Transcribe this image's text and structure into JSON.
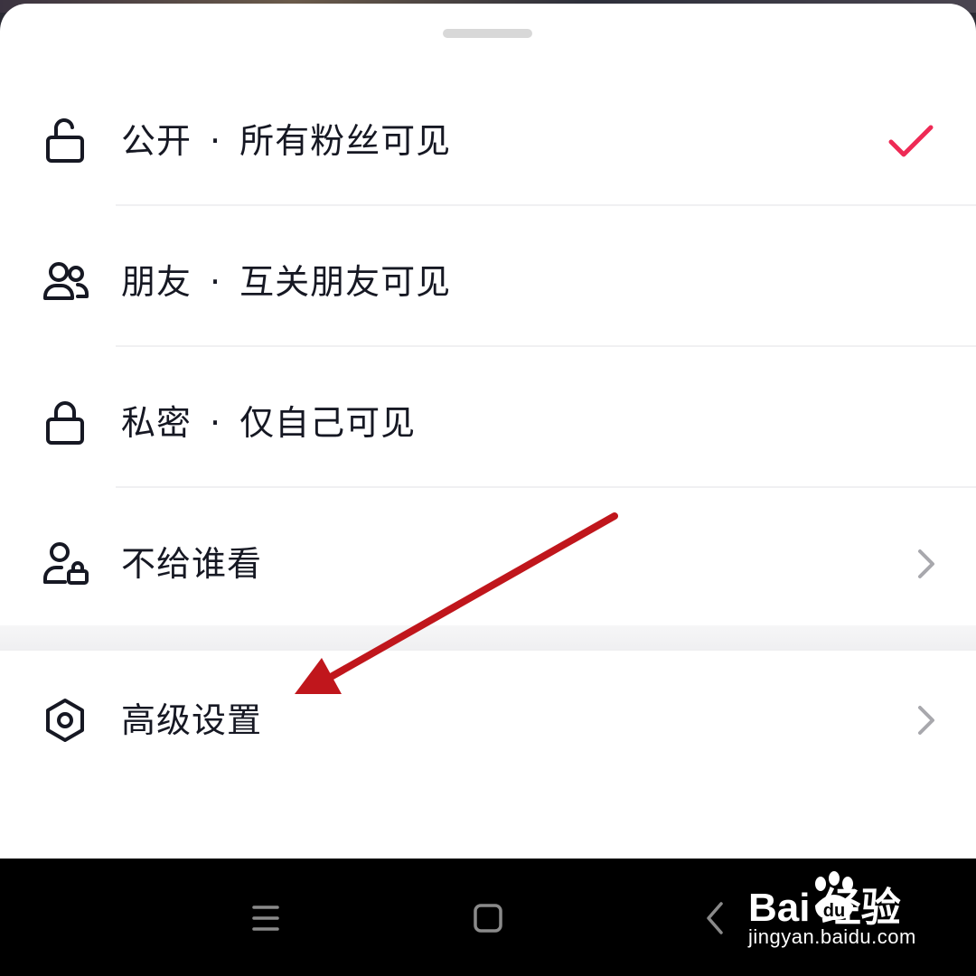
{
  "sheet": {
    "options": [
      {
        "title": "公开",
        "desc": "所有粉丝可见",
        "separator": "·",
        "icon": "unlock-icon",
        "selected": true
      },
      {
        "title": "朋友",
        "desc": "互关朋友可见",
        "separator": "·",
        "icon": "friends-icon",
        "selected": false
      },
      {
        "title": "私密",
        "desc": "仅自己可见",
        "separator": "·",
        "icon": "lock-icon",
        "selected": false
      },
      {
        "title": "不给谁看",
        "icon": "user-lock-icon",
        "has_chevron": true
      }
    ],
    "advanced": {
      "title": "高级设置",
      "icon": "hexagon-settings-icon",
      "has_chevron": true
    },
    "accent_color": "#ee2a55",
    "annotation_arrow_color": "#c0161c"
  },
  "navbar": {
    "buttons": [
      "menu-icon",
      "home-icon",
      "back-icon"
    ]
  },
  "watermark": {
    "brand": "Bai  经验",
    "brand_du": "du",
    "url": "jingyan.baidu.com"
  }
}
